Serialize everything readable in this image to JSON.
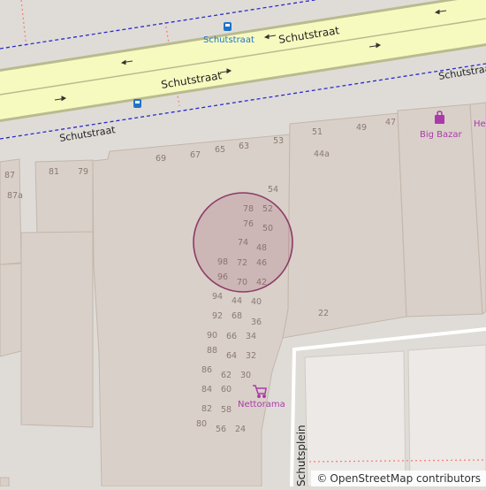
{
  "map": {
    "roads": [
      {
        "name": "Schutstraat"
      },
      {
        "name": "Schutstraat"
      },
      {
        "name": "Schutstraat"
      },
      {
        "name": "Schutstraat"
      },
      {
        "name": "Schutsplein"
      }
    ],
    "pois": [
      {
        "name": "Schutstraat",
        "kind": "bus-stop",
        "color": "#1f73c8"
      },
      {
        "name": "Big Bazar",
        "kind": "shop",
        "color": "#ac39ac"
      },
      {
        "name": "Nettorama",
        "kind": "supermarket",
        "color": "#ac39ac"
      },
      {
        "name": "He",
        "kind": "shop",
        "color": "#ac39ac"
      }
    ],
    "house_numbers": [
      "87",
      "81",
      "79",
      "87a",
      "69",
      "67",
      "65",
      "63",
      "53",
      "51",
      "49",
      "47",
      "44a",
      "54",
      "78",
      "52",
      "76",
      "50",
      "74",
      "48",
      "98",
      "72",
      "46",
      "96",
      "70",
      "42",
      "94",
      "44",
      "40",
      "92",
      "68",
      "36",
      "90",
      "66",
      "34",
      "88",
      "64",
      "32",
      "86",
      "62",
      "30",
      "84",
      "60",
      "82",
      "58",
      "80",
      "56",
      "24",
      "22"
    ],
    "highlight": {
      "color": "#a0526f"
    },
    "colors": {
      "background": "#dfdcd8",
      "building": "#d9d0c9",
      "building_outline": "#c4b6ab",
      "highway": "#f7fabf",
      "road_outline": "#b9bb8f",
      "bus_route": "#2c2cc9",
      "footway": "#fa8072"
    }
  },
  "attribution": {
    "copyright_symbol": "©",
    "text": "OpenStreetMap contributors"
  }
}
